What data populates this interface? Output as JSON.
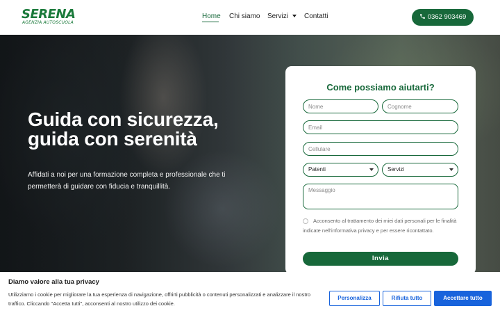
{
  "brand": {
    "name": "SERENA",
    "tagline": "AGENZIA AUTOSCUOLA",
    "color": "#17683a"
  },
  "nav": {
    "items": [
      {
        "label": "Home",
        "active": true
      },
      {
        "label": "Chi siamo"
      },
      {
        "label": "Servizi",
        "has_dropdown": true
      },
      {
        "label": "Contatti"
      }
    ],
    "phone": "0362 903469",
    "phone_icon": "phone-icon"
  },
  "hero": {
    "title_line1": "Guida con sicurezza,",
    "title_line2": "guida con serenità",
    "subtitle": "Affidati a noi per una formazione completa e professionale che ti permetterà di guidare con fiducia e tranquillità."
  },
  "form": {
    "title": "Come possiamo aiutarti?",
    "fields": {
      "nome": "Nome",
      "cognome": "Cognome",
      "email": "Email",
      "cellulare": "Cellulare",
      "messaggio": "Messaggio"
    },
    "selects": {
      "patenti": "Patenti",
      "servizi": "Servizi"
    },
    "consent": "Acconsento al trattamento dei miei dati personali per le finalità indicate nell'informativa privacy e per essere ricontattato.",
    "submit": "Invia"
  },
  "cookie": {
    "title": "Diamo valore alla tua privacy",
    "text": "Utilizziamo i cookie per migliorare la tua esperienza di navigazione, offrirti pubblicità o contenuti personalizzati e analizzare il nostro traffico. Cliccando \"Accetta tutti\", acconsenti al nostro utilizzo dei cookie.",
    "buttons": {
      "customize": "Personalizza",
      "reject": "Rifiuta tutto",
      "accept": "Accettare tutto"
    },
    "accent": "#1863dc"
  }
}
